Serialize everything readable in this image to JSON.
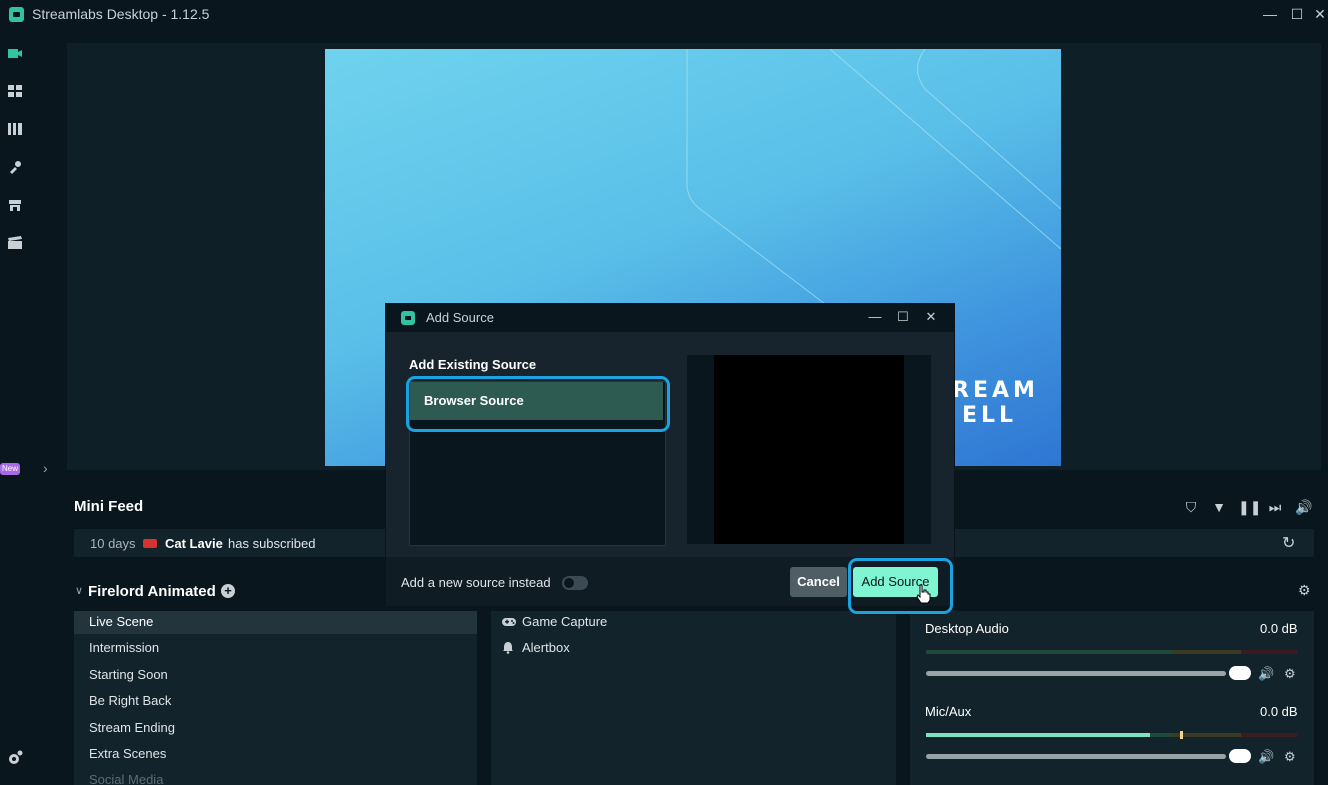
{
  "window": {
    "title": "Streamlabs Desktop - 1.12.5",
    "minimize": "—",
    "maximize": "☐",
    "close": "✕"
  },
  "sidebar": {
    "new_badge": "New",
    "collapse": "›"
  },
  "canvas": {
    "brand_line1": "REAM",
    "brand_line2": "ELL"
  },
  "mini_feed": {
    "title": "Mini Feed",
    "event": {
      "time": "10 days",
      "platform_icon": "youtube-icon",
      "user": "Cat Lavie",
      "action": "has subscribed"
    }
  },
  "scene_collection": {
    "name": "Firelord Animated",
    "add": "+"
  },
  "scenes": [
    "Live Scene",
    "Intermission",
    "Starting Soon",
    "Be Right Back",
    "Stream Ending",
    "Extra Scenes",
    "Social Media"
  ],
  "sources": [
    {
      "icon": "gamepad-icon",
      "label": "Game Capture"
    },
    {
      "icon": "bell-icon",
      "label": "Alertbox"
    }
  ],
  "mixer": [
    {
      "name": "Desktop Audio",
      "db": "0.0 dB"
    },
    {
      "name": "Mic/Aux",
      "db": "0.0 dB"
    }
  ],
  "modal": {
    "title": "Add Source",
    "existing_title": "Add Existing Source",
    "existing_items": [
      "Browser Source"
    ],
    "toggle_label": "Add a new source instead",
    "cancel": "Cancel",
    "add": "Add Source"
  },
  "colors": {
    "accent": "#31c3a2",
    "button_primary": "#80f5d2",
    "highlight": "#1aa3e0",
    "background": "#09161d"
  }
}
